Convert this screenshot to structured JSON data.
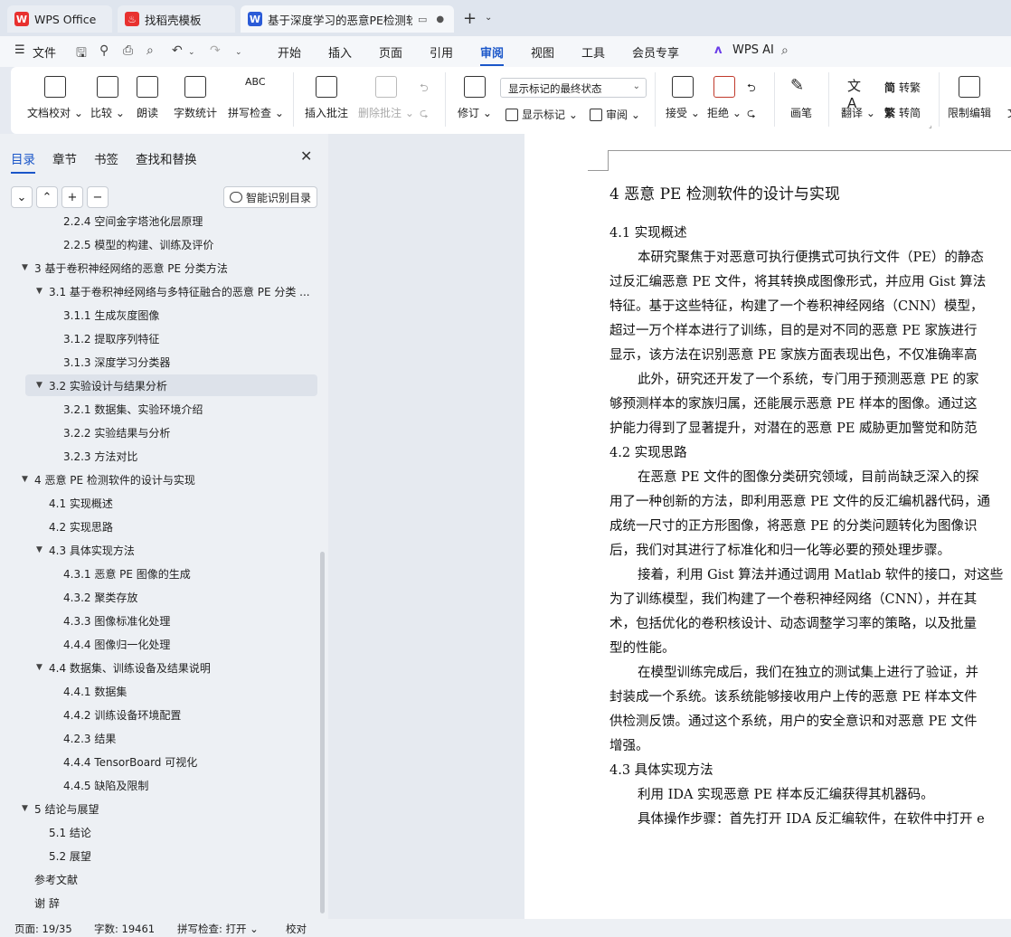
{
  "tabs": [
    {
      "label": "WPS Office",
      "icon": "wps-logo-icon"
    },
    {
      "label": "找稻壳模板",
      "icon": "daoke-logo-icon"
    },
    {
      "label": "基于深度学习的恶意PE检测软件",
      "icon": "wps-writer-icon",
      "active": true
    }
  ],
  "menu": {
    "file": "文件",
    "items": [
      "开始",
      "插入",
      "页面",
      "引用",
      "审阅",
      "视图",
      "工具",
      "会员专享"
    ],
    "active": "审阅",
    "wps_ai": "WPS AI"
  },
  "ribbon": {
    "doc_proof": "文档校对",
    "compare": "比较",
    "read_aloud": "朗读",
    "word_count": "字数统计",
    "spell_check": "拼写检查",
    "insert_comment": "插入批注",
    "delete_comment": "删除批注",
    "revise": "修订",
    "markup_state": "显示标记的最终状态",
    "show_markup": "显示标记",
    "review": "审阅",
    "accept": "接受",
    "reject": "拒绝",
    "pen": "画笔",
    "translate": "翻译",
    "to_traditional": "转繁",
    "to_simplified": "转简",
    "restrict_edit": "限制编辑",
    "doc_right_partial": "文"
  },
  "sidebar": {
    "tabs": [
      "目录",
      "章节",
      "书签",
      "查找和替换"
    ],
    "active_tab": "目录",
    "smart_toc": "智能识别目录",
    "toc": [
      {
        "label": "2.2.4  空间金字塔池化层原理",
        "level": 3
      },
      {
        "label": "2.2.5  模型的构建、训练及评价",
        "level": 3
      },
      {
        "label": "3  基于卷积神经网络的恶意 PE 分类方法",
        "level": 1,
        "expanded": true
      },
      {
        "label": "3.1  基于卷积神经网络与多特征融合的恶意 PE 分类 ...",
        "level": 2,
        "expanded": true
      },
      {
        "label": "3.1.1  生成灰度图像",
        "level": 3
      },
      {
        "label": "3.1.2  提取序列特征",
        "level": 3
      },
      {
        "label": "3.1.3  深度学习分类器",
        "level": 3
      },
      {
        "label": "3.2  实验设计与结果分析",
        "level": 2,
        "expanded": true,
        "selected": true
      },
      {
        "label": "3.2.1  数据集、实验环境介绍",
        "level": 3
      },
      {
        "label": "3.2.2  实验结果与分析",
        "level": 3
      },
      {
        "label": "3.2.3  方法对比",
        "level": 3
      },
      {
        "label": "4  恶意 PE 检测软件的设计与实现",
        "level": 1,
        "expanded": true
      },
      {
        "label": "4.1  实现概述",
        "level": 2
      },
      {
        "label": "4.2  实现思路",
        "level": 2
      },
      {
        "label": "4.3 具体实现方法",
        "level": 2,
        "expanded": true
      },
      {
        "label": "4.3.1 恶意 PE 图像的生成",
        "level": 3
      },
      {
        "label": "4.3.2 聚类存放",
        "level": 3
      },
      {
        "label": "4.3.3 图像标准化处理",
        "level": 3
      },
      {
        "label": "4.4.4 图像归一化处理",
        "level": 3
      },
      {
        "label": "4.4 数据集、训练设备及结果说明",
        "level": 2,
        "expanded": true
      },
      {
        "label": "4.4.1 数据集",
        "level": 3
      },
      {
        "label": "4.4.2 训练设备环境配置",
        "level": 3
      },
      {
        "label": "4.2.3  结果",
        "level": 3
      },
      {
        "label": "4.4.4 TensorBoard 可视化",
        "level": 3
      },
      {
        "label": "4.4.5  缺陷及限制",
        "level": 3
      },
      {
        "label": "5  结论与展望",
        "level": 1,
        "expanded": true
      },
      {
        "label": "5.1  结论",
        "level": 2
      },
      {
        "label": "5.2  展望",
        "level": 2
      },
      {
        "label": "参考文献",
        "level": 1
      },
      {
        "label": "谢    辞",
        "level": 1
      }
    ]
  },
  "document": {
    "heading": "4  恶意 PE 检测软件的设计与实现",
    "lines": [
      {
        "type": "h2",
        "text": "4.1  实现概述"
      },
      {
        "type": "p",
        "text": "本研究聚焦于对恶意可执行便携式可执行文件（PE）的静态",
        "indent": true
      },
      {
        "type": "p",
        "text": "过反汇编恶意 PE 文件，将其转换成图像形式，并应用 Gist 算法"
      },
      {
        "type": "p",
        "text": "特征。基于这些特征，构建了一个卷积神经网络（CNN）模型，"
      },
      {
        "type": "p",
        "text": "超过一万个样本进行了训练，目的是对不同的恶意 PE 家族进行"
      },
      {
        "type": "p",
        "text": "显示，该方法在识别恶意 PE 家族方面表现出色，不仅准确率高"
      },
      {
        "type": "p",
        "text": "此外，研究还开发了一个系统，专门用于预测恶意 PE 的家",
        "indent": true
      },
      {
        "type": "p",
        "text": "够预测样本的家族归属，还能展示恶意 PE 样本的图像。通过这"
      },
      {
        "type": "p",
        "text": "护能力得到了显著提升，对潜在的恶意 PE 威胁更加警觉和防范"
      },
      {
        "type": "h2",
        "text": "4.2  实现思路"
      },
      {
        "type": "p",
        "text": "在恶意 PE 文件的图像分类研究领域，目前尚缺乏深入的探",
        "indent": true
      },
      {
        "type": "p",
        "text": "用了一种创新的方法，即利用恶意 PE 文件的反汇编机器代码，通"
      },
      {
        "type": "p",
        "text": "成统一尺寸的正方形图像，将恶意 PE 的分类问题转化为图像识"
      },
      {
        "type": "p",
        "text": "后，我们对其进行了标准化和归一化等必要的预处理步骤。"
      },
      {
        "type": "p",
        "text": "接着，利用 Gist 算法并通过调用 Matlab 软件的接口，对这些",
        "indent": true
      },
      {
        "type": "p",
        "text": "为了训练模型，我们构建了一个卷积神经网络（CNN），并在其"
      },
      {
        "type": "p",
        "text": "术，包括优化的卷积核设计、动态调整学习率的策略，以及批量"
      },
      {
        "type": "p",
        "text": "型的性能。"
      },
      {
        "type": "p",
        "text": "在模型训练完成后，我们在独立的测试集上进行了验证，并",
        "indent": true
      },
      {
        "type": "p",
        "text": "封装成一个系统。该系统能够接收用户上传的恶意 PE 样本文件"
      },
      {
        "type": "p",
        "text": "供检测反馈。通过这个系统，用户的安全意识和对恶意 PE 文件"
      },
      {
        "type": "p",
        "text": "增强。"
      },
      {
        "type": "h2",
        "text": "4.3 具体实现方法"
      },
      {
        "type": "p",
        "text": "利用 IDA 实现恶意 PE 样本反汇编获得其机器码。",
        "indent": true
      },
      {
        "type": "p",
        "text": "具体操作步骤：首先打开 IDA 反汇编软件，在软件中打开 e",
        "indent": true
      }
    ]
  },
  "status": {
    "page": "页面: 19/35",
    "words": "字数: 19461",
    "spell": "拼写检查: 打开",
    "proof": "校对"
  },
  "colors": {
    "accent": "#1a56c9",
    "wps_red": "#e8312f",
    "writer_blue": "#2b5bd7"
  }
}
